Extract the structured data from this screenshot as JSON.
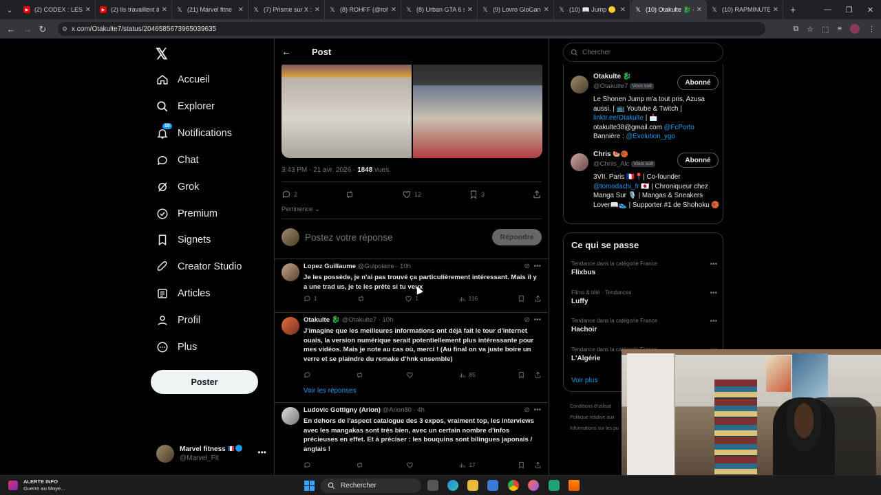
{
  "browser": {
    "tabs": [
      {
        "title": "(2) CODEX : LES A",
        "icon": "youtube-icon"
      },
      {
        "title": "(2) Ils travaillent à",
        "icon": "youtube-icon"
      },
      {
        "title": "(21) Marvel fitne",
        "icon": "x-icon"
      },
      {
        "title": "(7) Prisme sur X :",
        "icon": "x-icon"
      },
      {
        "title": "(8) ROHFF (@roh",
        "icon": "x-icon"
      },
      {
        "title": "(8) Urban GTA 6 s",
        "icon": "x-icon"
      },
      {
        "title": "(9) Lovro GloGan",
        "icon": "x-icon"
      },
      {
        "title": "(10) 📖 Jump 🟡",
        "icon": "x-icon"
      },
      {
        "title": "(10) Otakulte 🐉 ·",
        "icon": "x-icon",
        "active": true
      },
      {
        "title": "(10) RAPMINUTE",
        "icon": "x-icon"
      }
    ],
    "url": "x.com/Otakulte7/status/2046585673965039635"
  },
  "nav": {
    "items": [
      {
        "label": "Accueil",
        "icon": "home-icon"
      },
      {
        "label": "Explorer",
        "icon": "search-icon"
      },
      {
        "label": "Notifications",
        "icon": "bell-icon",
        "badge": "10"
      },
      {
        "label": "Chat",
        "icon": "chat-icon"
      },
      {
        "label": "Grok",
        "icon": "grok-icon"
      },
      {
        "label": "Premium",
        "icon": "premium-icon"
      },
      {
        "label": "Signets",
        "icon": "bookmark-icon"
      },
      {
        "label": "Creator Studio",
        "icon": "rocket-icon"
      },
      {
        "label": "Articles",
        "icon": "article-icon"
      },
      {
        "label": "Profil",
        "icon": "person-icon"
      },
      {
        "label": "Plus",
        "icon": "more-icon"
      }
    ],
    "post_button": "Poster",
    "account": {
      "name": "Marvel fitness",
      "handle": "@Marvel_Flt"
    }
  },
  "post": {
    "header_title": "Post",
    "meta_time": "3:43 PM · 21 avr. 2026 · ",
    "meta_views": "1848",
    "meta_views_label": " vues",
    "stats": {
      "replies": "2",
      "likes": "12",
      "bookmarks": "3"
    },
    "sort_label": "Pertinence",
    "reply_placeholder": "Postez votre réponse",
    "reply_button": "Répondre"
  },
  "replies": [
    {
      "name": "Lopez Guillaume",
      "handle": "@Gulpolaire · 10h",
      "text": "Je les possède, je n'ai pas trouvé ça particulièrement intéressant. Mais il y a une trad us, je te les prête si tu veux",
      "replies": "1",
      "likes": "1",
      "views": "116"
    },
    {
      "name": "Otakulte",
      "handle": "@Otakulte7 · 10h",
      "text": "J'imagine que les meilleures informations ont déjà fait le tour d'internet ouais, la version numérique serait potentiellement plus intéressante pour mes vidéos. Mais je note au cas où, merci ! (Au final on va juste boire un verre et se plaindre du remake d'hnk ensemble)",
      "replies": "",
      "likes": "",
      "views": "85",
      "see_replies": "Voir les réponses"
    },
    {
      "name": "Ludovic Gottigny (Arion)",
      "handle": "@Arion80 · 4h",
      "text": "En dehors de l'aspect catalogue des 3 expos, vraiment top, les interviews avec les mangakas sont très bien, avec un certain nombre d'infos précieuses en effet. Et à préciser : les bouquins sont bilingues japonais / anglais !",
      "replies": "",
      "likes": "",
      "views": "17"
    }
  ],
  "right": {
    "search_placeholder": "Chercher",
    "profiles": [
      {
        "name": "Otakulte",
        "handle": "@Otakulte7",
        "follows_you": "Vous suit",
        "button": "Abonné",
        "bio_1": "Le Shonen Jump m'a tout pris, Azusa aussi. | 📺 Youtube & Twitch | ",
        "bio_link": "linktr.ee/Otakulte",
        "bio_2": " | 📩 otakulte38@gmail.com ",
        "bio_mention": "@FcPorto",
        "bio_3": " Bannière : ",
        "bio_mention2": "@Evolution_ygo"
      },
      {
        "name": "Chris",
        "handle": "@Chrils_Alc",
        "follows_you": "Vous suit",
        "button": "Abonné",
        "bio_1": "3VII. Paris 🇫🇷📍| Co-founder ",
        "bio_link": "@tomodachi_fr",
        "bio_2": " 🇯🇵 | Chroniqueur chez Manga Sur 🎙️ | Mangas & Sneakers Lover📖👟 | Supporter #1 de Shohoku 🏀"
      }
    ],
    "trends_title": "Ce qui se passe",
    "trends": [
      {
        "category": "Tendance dans la catégorie France",
        "name": "Flixbus"
      },
      {
        "category": "Films & télé · Tendances",
        "name": "Luffy"
      },
      {
        "category": "Tendance dans la catégorie France",
        "name": "Hachoir"
      },
      {
        "category": "Tendance dans la catégorie France",
        "name": "L'Algérie"
      }
    ],
    "show_more": "Voir plus",
    "footer": [
      "Conditions d'utilisat",
      "Politique relative aux",
      "Informations sur les pu"
    ]
  },
  "taskbar": {
    "alert_title": "ALERTE INFO",
    "alert_text": "Guerre au Moye...",
    "search": "Rechercher"
  }
}
